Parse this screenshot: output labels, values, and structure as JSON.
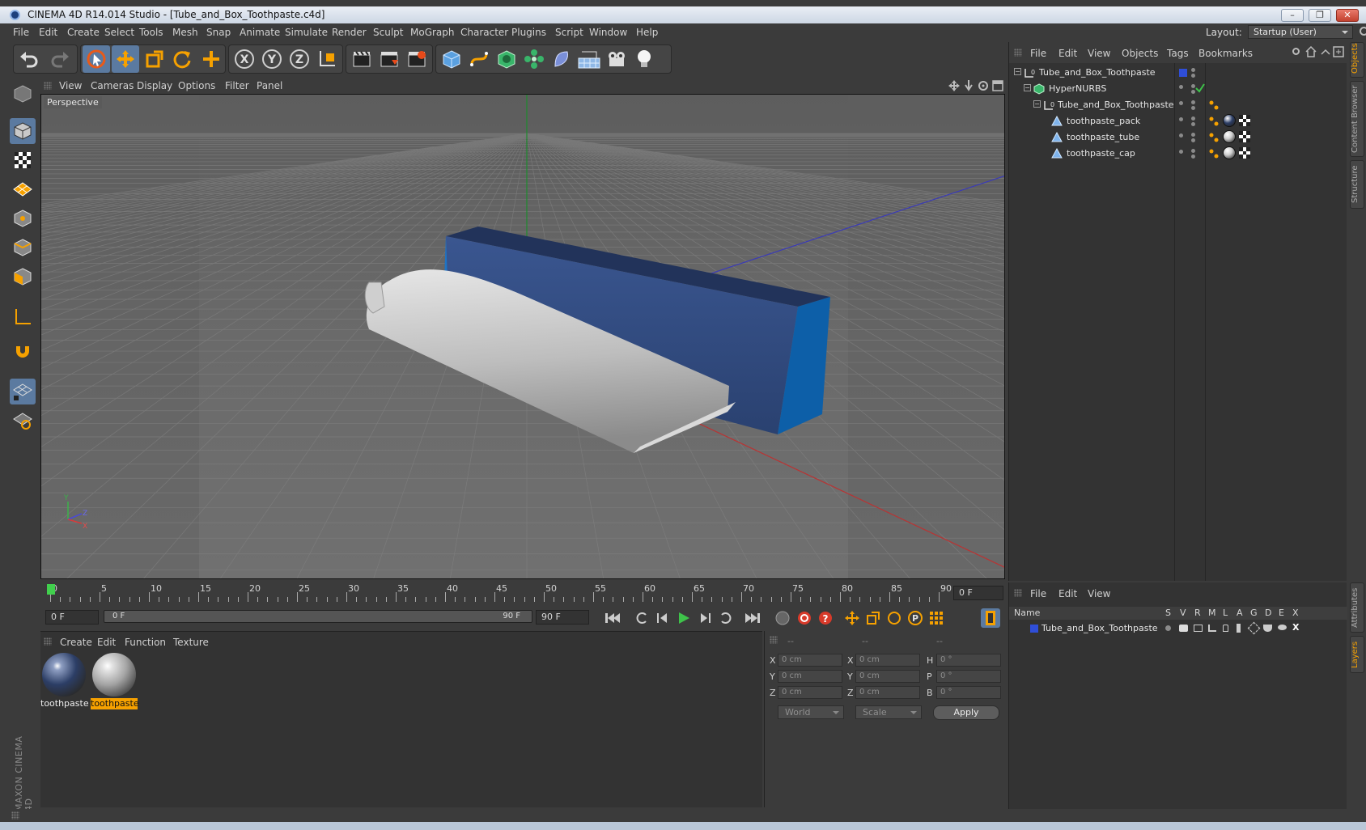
{
  "window": {
    "title": "CINEMA 4D R14.014 Studio - [Tube_and_Box_Toothpaste.c4d]",
    "minimize_icon": "minimize-icon",
    "restore_icon": "restore-icon",
    "close_icon": "close-icon"
  },
  "menubar": {
    "items": [
      "File",
      "Edit",
      "Create",
      "Select",
      "Tools",
      "Mesh",
      "Snap",
      "Animate",
      "Simulate",
      "Render",
      "Sculpt",
      "MoGraph",
      "Character",
      "Plugins",
      "Script",
      "Window",
      "Help"
    ],
    "layout_label": "Layout:",
    "layout_value": "Startup (User)"
  },
  "toolbar": {
    "icons": [
      "undo-icon",
      "redo-icon",
      "live-select-icon",
      "move-icon",
      "scale-icon",
      "rotate-icon",
      "add-icon",
      "x-axis-icon",
      "y-axis-icon",
      "z-axis-icon",
      "coordinate-system-icon",
      "render-view-icon",
      "render-picture-viewer-icon",
      "render-settings-icon",
      "cube-primitive-icon",
      "spline-icon",
      "nurbs-icon",
      "array-icon",
      "deformer-icon",
      "floor-icon",
      "camera-icon",
      "light-icon"
    ]
  },
  "left_tools": {
    "icons": [
      "model-mode-icon",
      "texture-mode-icon",
      "workplane-mode-icon",
      "points-mode-icon",
      "edges-mode-icon",
      "polygons-mode-icon",
      "axis-mode-icon",
      "magnet-icon",
      "grid-snap-icon",
      "animation-lock-icon"
    ]
  },
  "viewport": {
    "menu": [
      "View",
      "Cameras",
      "Display",
      "Options",
      "Filter",
      "Panel"
    ],
    "label": "Perspective",
    "axis_labels": {
      "y": "Y",
      "z": "Z",
      "x": "X"
    }
  },
  "timeline": {
    "ticks": [
      0,
      5,
      10,
      15,
      20,
      25,
      30,
      35,
      40,
      45,
      50,
      55,
      60,
      65,
      70,
      75,
      80,
      85,
      90
    ],
    "current_frame": "0 F",
    "start_frame": "0 F",
    "slider_start": "0 F",
    "slider_end": "90 F",
    "end_frame": "90 F",
    "progress_fraction": 0
  },
  "materials": {
    "menu": [
      "Create",
      "Edit",
      "Function",
      "Texture"
    ],
    "items": [
      {
        "name": "toothpaste",
        "color": "#2c3e66",
        "selected": false
      },
      {
        "name": "toothpaste",
        "color": "#c9c9c9",
        "selected": true
      }
    ]
  },
  "coordinates": {
    "headers": [
      "--",
      "--",
      "--"
    ],
    "rows": [
      {
        "pos_label": "X",
        "pos": "0 cm",
        "size_label": "X",
        "size": "0 cm",
        "rot_label": "H",
        "rot": "0 °"
      },
      {
        "pos_label": "Y",
        "pos": "0 cm",
        "size_label": "Y",
        "size": "0 cm",
        "rot_label": "P",
        "rot": "0 °"
      },
      {
        "pos_label": "Z",
        "pos": "0 cm",
        "size_label": "Z",
        "size": "0 cm",
        "rot_label": "B",
        "rot": "0 °"
      }
    ],
    "mode": "World",
    "transform": "Scale",
    "apply": "Apply"
  },
  "objects": {
    "menu": [
      "File",
      "Edit",
      "View",
      "Objects",
      "Tags",
      "Bookmarks"
    ],
    "tree": [
      {
        "name": "Tube_and_Box_Toothpaste",
        "type": "null-icon"
      },
      {
        "name": "HyperNURBS",
        "type": "hypernurbs-icon"
      },
      {
        "name": "Tube_and_Box_Toothpaste",
        "type": "null-icon"
      },
      {
        "name": "toothpaste_pack",
        "type": "polygon-object-icon"
      },
      {
        "name": "toothpaste_tube",
        "type": "polygon-object-icon"
      },
      {
        "name": "toothpaste_cap",
        "type": "polygon-object-icon"
      }
    ]
  },
  "layers": {
    "menu": [
      "File",
      "Edit",
      "View"
    ],
    "columns": [
      "Name",
      "S",
      "V",
      "R",
      "M",
      "L",
      "A",
      "G",
      "D",
      "E",
      "X"
    ],
    "rows": [
      {
        "name": "Tube_and_Box_Toothpaste",
        "color": "#2f4ed8"
      }
    ]
  },
  "right_tabs": [
    "Objects",
    "Content Browser",
    "Structure",
    "Attributes",
    "Layers"
  ],
  "branding": {
    "text": "MAXON CINEMA 4D"
  }
}
